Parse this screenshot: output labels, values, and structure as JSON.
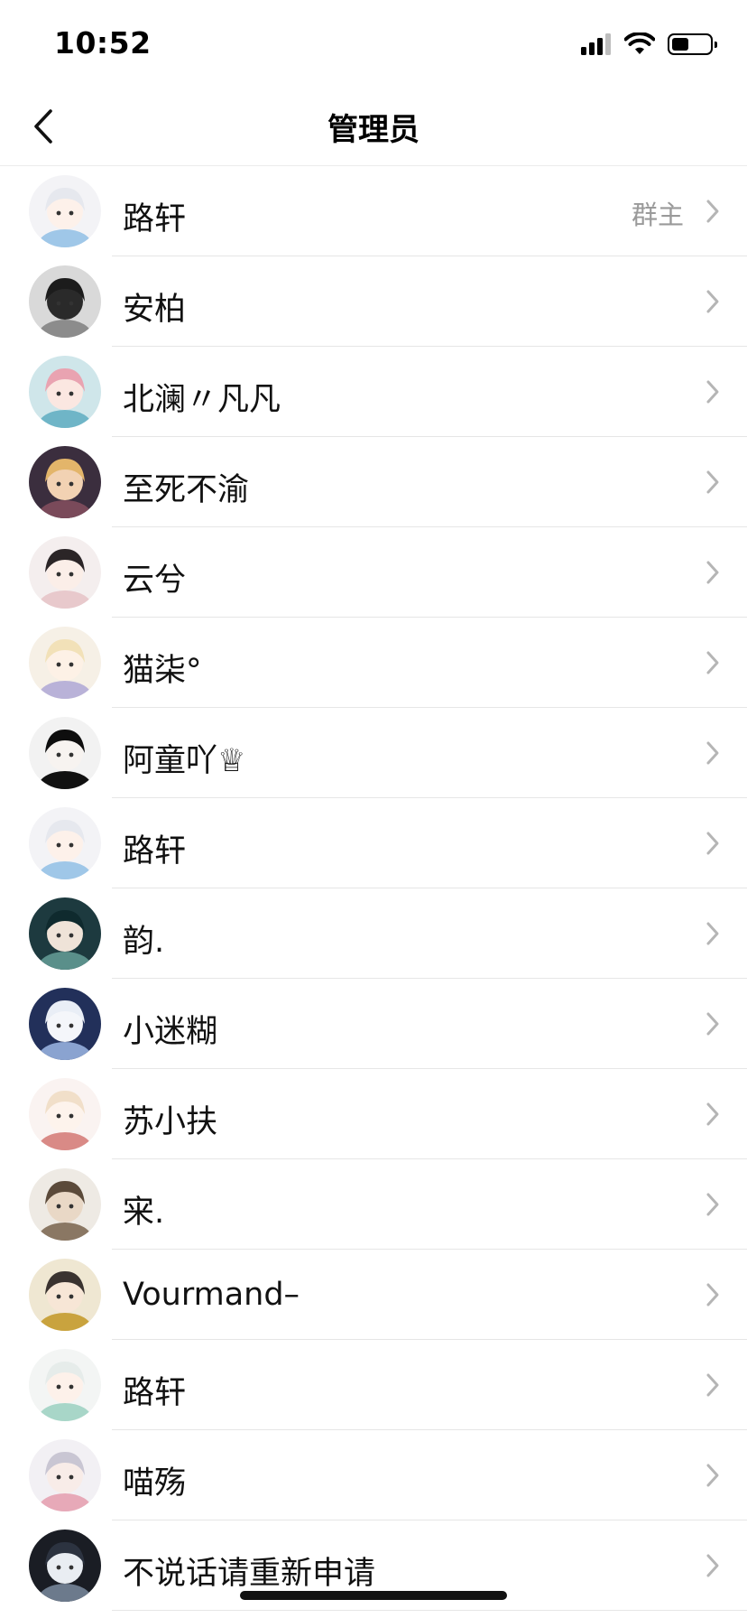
{
  "status_bar": {
    "time": "10:52",
    "battery_level": 0.45
  },
  "nav": {
    "title": "管理员"
  },
  "members": [
    {
      "name": "路轩",
      "badge": "群主",
      "avatar": {
        "bg": "#f3f3f6",
        "hair": "#e6e8ee",
        "skin": "#fdf1ea",
        "accent": "#9fc7e8"
      }
    },
    {
      "name": "安柏",
      "badge": "",
      "avatar": {
        "bg": "#d9d9d9",
        "hair": "#1c1c1c",
        "skin": "#2a2a2a",
        "accent": "#8c8c8c"
      }
    },
    {
      "name": "北澜〃凡凡",
      "badge": "",
      "avatar": {
        "bg": "#cfe6ea",
        "hair": "#e9a3b1",
        "skin": "#fbe7e1",
        "accent": "#6fb5c7"
      }
    },
    {
      "name": "至死不渝",
      "badge": "",
      "avatar": {
        "bg": "#3b2e3e",
        "hair": "#e3b56a",
        "skin": "#f2d2b3",
        "accent": "#7a4a5a"
      }
    },
    {
      "name": "云兮",
      "badge": "",
      "avatar": {
        "bg": "#f4eeee",
        "hair": "#2b2527",
        "skin": "#fbeee8",
        "accent": "#e8c9cc"
      }
    },
    {
      "name": "猫柒°",
      "badge": "",
      "avatar": {
        "bg": "#f6f0e6",
        "hair": "#f2e1b8",
        "skin": "#fdf1e6",
        "accent": "#b9b2d8"
      }
    },
    {
      "name": "阿童吖♕",
      "badge": "",
      "avatar": {
        "bg": "#f2f2f2",
        "hair": "#0e0e0e",
        "skin": "#f7f3f0",
        "accent": "#111111"
      }
    },
    {
      "name": "路轩",
      "badge": "",
      "avatar": {
        "bg": "#f3f3f6",
        "hair": "#e6e8ee",
        "skin": "#fdf1ea",
        "accent": "#9fc7e8"
      }
    },
    {
      "name": "韵.",
      "badge": "",
      "avatar": {
        "bg": "#1d3a3f",
        "hair": "#0f2a2e",
        "skin": "#efe3d8",
        "accent": "#5a8f8a"
      }
    },
    {
      "name": "小迷糊",
      "badge": "",
      "avatar": {
        "bg": "#22305a",
        "hair": "#e9eef6",
        "skin": "#f4f6fa",
        "accent": "#8aa3d0"
      }
    },
    {
      "name": "苏小扶",
      "badge": "",
      "avatar": {
        "bg": "#faf3f1",
        "hair": "#f1dfc9",
        "skin": "#fdf3ec",
        "accent": "#d98a86"
      }
    },
    {
      "name": "宩.",
      "badge": "",
      "avatar": {
        "bg": "#eeeae4",
        "hair": "#5b4a3a",
        "skin": "#e9d8c6",
        "accent": "#8a7763"
      }
    },
    {
      "name": "Vourmand–",
      "badge": "",
      "avatar": {
        "bg": "#efe7d2",
        "hair": "#3a3330",
        "skin": "#f7e6d6",
        "accent": "#c9a33e"
      }
    },
    {
      "name": "路轩",
      "badge": "",
      "avatar": {
        "bg": "#f3f5f4",
        "hair": "#e6ecea",
        "skin": "#fdf1ea",
        "accent": "#a8d6c8"
      }
    },
    {
      "name": "喵殇",
      "badge": "",
      "avatar": {
        "bg": "#f2f0f4",
        "hair": "#c9c6d3",
        "skin": "#f8ece8",
        "accent": "#e7a9b8"
      }
    },
    {
      "name": "不说话请重新申请",
      "badge": "",
      "avatar": {
        "bg": "#1a1d24",
        "hair": "#2c3340",
        "skin": "#e9edf2",
        "accent": "#6c7a8c"
      }
    }
  ]
}
